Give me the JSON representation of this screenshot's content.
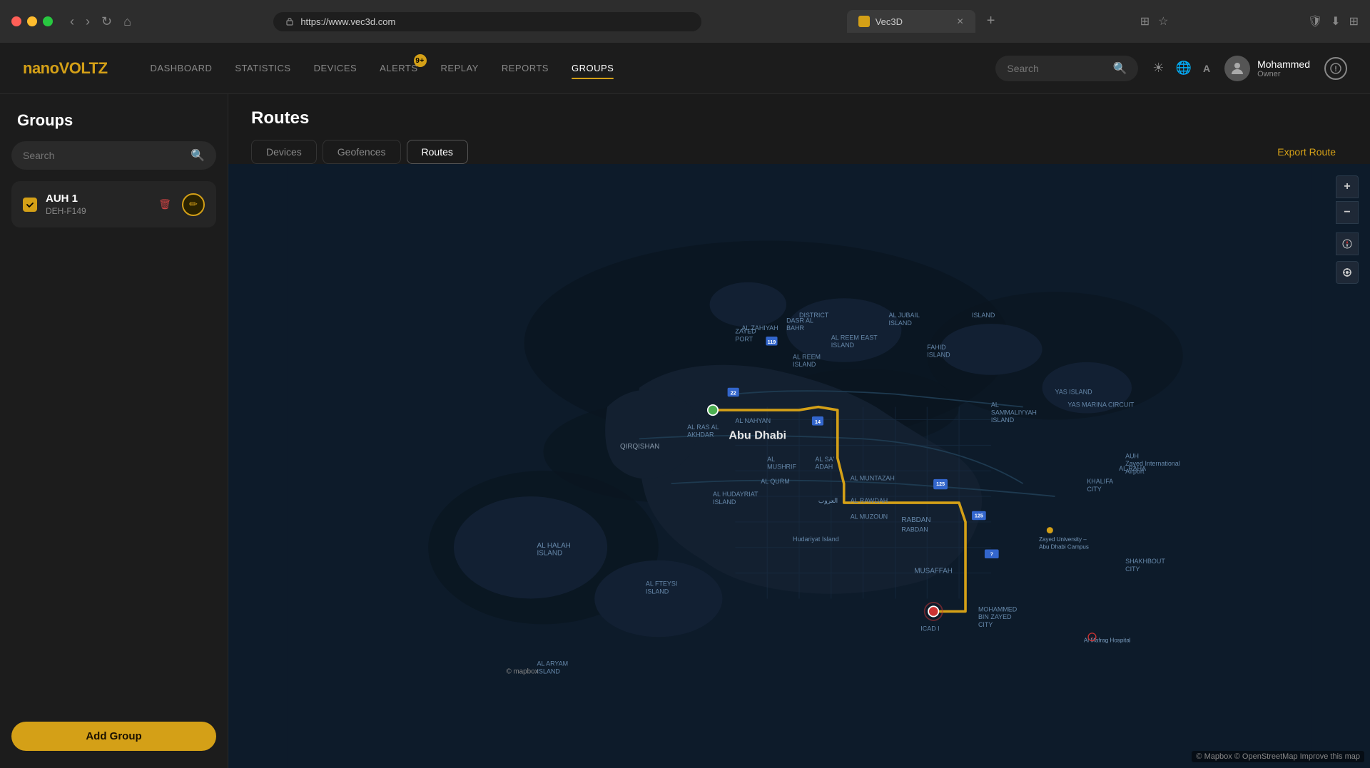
{
  "browser": {
    "tab_title": "Vec3D",
    "url": "https://www.vec3d.com",
    "new_tab_label": "+"
  },
  "header": {
    "logo_nano": "nano",
    "logo_voltz": "VOLTZ",
    "nav": [
      {
        "id": "dashboard",
        "label": "DASHBOARD",
        "active": false,
        "badge": null
      },
      {
        "id": "statistics",
        "label": "STATISTICS",
        "active": false,
        "badge": null
      },
      {
        "id": "devices",
        "label": "DEVICES",
        "active": false,
        "badge": null
      },
      {
        "id": "alerts",
        "label": "ALERTS",
        "active": false,
        "badge": "9+"
      },
      {
        "id": "replay",
        "label": "REPLAY",
        "active": false,
        "badge": null
      },
      {
        "id": "reports",
        "label": "REPORTS",
        "active": false,
        "badge": null
      },
      {
        "id": "groups",
        "label": "GROUPS",
        "active": true,
        "badge": null
      }
    ],
    "search_placeholder": "Search",
    "user_name": "Mohammed",
    "user_role": "Owner"
  },
  "sidebar": {
    "title": "Groups",
    "search_placeholder": "Search",
    "groups": [
      {
        "name": "AUH 1",
        "device": "DEH-F149",
        "checked": true
      }
    ],
    "add_group_label": "Add Group"
  },
  "content": {
    "page_title": "Routes",
    "tabs": [
      {
        "id": "devices",
        "label": "Devices",
        "active": false
      },
      {
        "id": "geofences",
        "label": "Geofences",
        "active": false
      },
      {
        "id": "routes",
        "label": "Routes",
        "active": true
      }
    ],
    "export_label": "Export Route"
  },
  "map": {
    "attribution": "© Mapbox © OpenStreetMap Improve this map",
    "logo": "© Mapbox"
  },
  "icons": {
    "search": "🔍",
    "sun": "☀",
    "globe": "🌐",
    "translate": "A",
    "zoom_in": "+",
    "zoom_out": "−",
    "compass": "◎",
    "location": "⊕",
    "delete": "🗑",
    "edit": "✏"
  }
}
